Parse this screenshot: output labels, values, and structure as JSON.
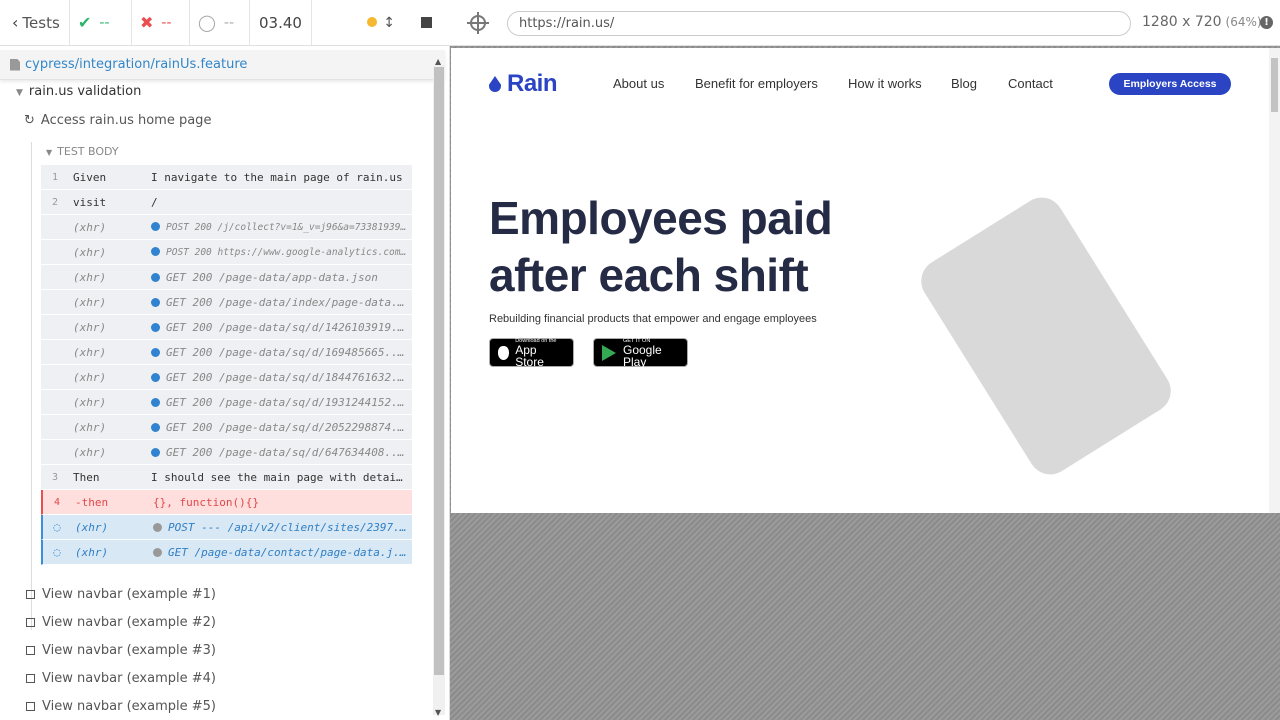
{
  "runner": {
    "tests_label": "Tests",
    "passed": "--",
    "failed": "--",
    "pending": "--",
    "time": "03.40",
    "spec_path": "cypress/integration/rainUs.feature",
    "suite_title": "rain.us validation",
    "test_title": "Access rain.us home page",
    "body_label": "TEST BODY",
    "commands": [
      {
        "num": "1",
        "name": "Given",
        "msg": "I navigate to the main page of rain.us",
        "kind": "step"
      },
      {
        "num": "2",
        "name": "visit",
        "msg": "/",
        "kind": "step"
      },
      {
        "num": "",
        "name": "(xhr)",
        "msg": "POST 200 /j/collect?v=1&_v=j96&a=73381939...",
        "kind": "xhr-small"
      },
      {
        "num": "",
        "name": "(xhr)",
        "msg": "POST 200 https://www.google-analytics.com...",
        "kind": "xhr-small"
      },
      {
        "num": "",
        "name": "(xhr)",
        "msg": "GET 200 /page-data/app-data.json",
        "kind": "xhr"
      },
      {
        "num": "",
        "name": "(xhr)",
        "msg": "GET 200 /page-data/index/page-data...",
        "kind": "xhr"
      },
      {
        "num": "",
        "name": "(xhr)",
        "msg": "GET 200 /page-data/sq/d/1426103919...",
        "kind": "xhr"
      },
      {
        "num": "",
        "name": "(xhr)",
        "msg": "GET 200 /page-data/sq/d/169485665....",
        "kind": "xhr"
      },
      {
        "num": "",
        "name": "(xhr)",
        "msg": "GET 200 /page-data/sq/d/1844761632...",
        "kind": "xhr"
      },
      {
        "num": "",
        "name": "(xhr)",
        "msg": "GET 200 /page-data/sq/d/1931244152...",
        "kind": "xhr"
      },
      {
        "num": "",
        "name": "(xhr)",
        "msg": "GET 200 /page-data/sq/d/2052298874...",
        "kind": "xhr"
      },
      {
        "num": "",
        "name": "(xhr)",
        "msg": "GET 200 /page-data/sq/d/647634408....",
        "kind": "xhr"
      },
      {
        "num": "3",
        "name": "Then",
        "msg": "I should see the main page with detai...",
        "kind": "step"
      },
      {
        "num": "4",
        "name": "-then",
        "msg": "{}, function(){}",
        "kind": "fail"
      },
      {
        "num": "",
        "name": "(xhr)",
        "msg": "POST --- /api/v2/client/sites/2397...",
        "kind": "pending"
      },
      {
        "num": "",
        "name": "(xhr)",
        "msg": "GET /page-data/contact/page-data.j...",
        "kind": "pending"
      }
    ],
    "examples": [
      "View navbar (example #1)",
      "View navbar (example #2)",
      "View navbar (example #3)",
      "View navbar (example #4)",
      "View navbar (example #5)"
    ]
  },
  "browser": {
    "url": "https://rain.us/",
    "dimensions": "1280 x 720",
    "zoom": "(64%)"
  },
  "site": {
    "logo": "Rain",
    "nav": [
      "About us",
      "Benefit for employers",
      "How it works",
      "Blog",
      "Contact"
    ],
    "cta": "Employers Access",
    "hero_line1": "Employees paid",
    "hero_line2": "after each shift",
    "subtitle": "Rebuilding financial products that empower and engage employees",
    "appstore_small": "Download on the",
    "appstore_large": "App Store",
    "play_small": "GET IT ON",
    "play_large": "Google Play",
    "brand_color": "#2b44c4"
  }
}
